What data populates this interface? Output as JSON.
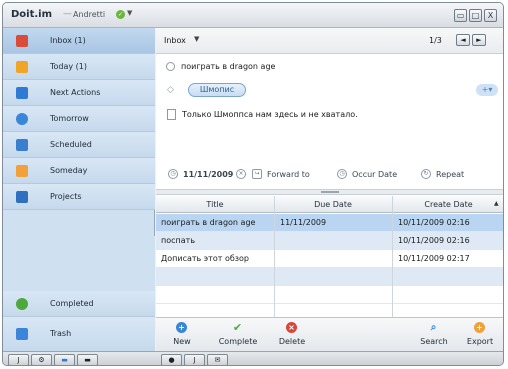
{
  "window": {
    "app_title": "Doit.im",
    "separator": "—",
    "user": "Andretti",
    "controls": {
      "minimize": "▭",
      "maximize": "□",
      "close": "X"
    }
  },
  "sidebar": {
    "items": [
      {
        "label": "Inbox (1)",
        "icon": "inbox-icon",
        "color": "#d94b3b",
        "selected": true
      },
      {
        "label": "Today (1)",
        "icon": "today-star-icon",
        "color": "#f1a528",
        "selected": false
      },
      {
        "label": "Next Actions",
        "icon": "next-actions-icon",
        "color": "#2f7bd4",
        "selected": false
      },
      {
        "label": "Tomorrow",
        "icon": "tomorrow-icon",
        "color": "#3a86d8",
        "selected": false
      },
      {
        "label": "Scheduled",
        "icon": "scheduled-calendar-icon",
        "color": "#3a7fcf",
        "selected": false
      },
      {
        "label": "Someday",
        "icon": "someday-folder-icon",
        "color": "#f0a13a",
        "selected": false
      },
      {
        "label": "Projects",
        "icon": "projects-icon",
        "color": "#2f6fbf",
        "selected": false
      },
      {
        "label": "Completed",
        "icon": "completed-check-icon",
        "color": "#4caa3c",
        "selected": false
      },
      {
        "label": "Trash",
        "icon": "trash-icon",
        "color": "#3a86d8",
        "selected": false
      }
    ]
  },
  "detail": {
    "box": "Inbox",
    "pager": "1/3",
    "prev": "◄",
    "next": "►",
    "task_title": "поиграть в dragon age",
    "tag": "Шмопис",
    "tag_add": "+▾",
    "note": "Только Шмоппса нам здесь и не хватало.",
    "meta": {
      "date": "11/11/2009",
      "forward": "Forward to",
      "occur": "Occur Date",
      "repeat": "Repeat"
    }
  },
  "grid": {
    "columns": [
      "Title",
      "Due Date",
      "Create Date"
    ],
    "sort_indicator": "▲",
    "rows": [
      {
        "title": "поиграть в dragon age",
        "due": "11/11/2009",
        "created": "10/11/2009 02:16",
        "selected": true
      },
      {
        "title": "поспать",
        "due": "",
        "created": "10/11/2009 02:16",
        "selected": false
      },
      {
        "title": "Дописать этот обзор",
        "due": "",
        "created": "10/11/2009 02:17",
        "selected": false
      }
    ]
  },
  "toolbar": {
    "new": "New",
    "complete": "Complete",
    "delete": "Delete",
    "search": "Search",
    "export": "Export"
  },
  "statusbar": {
    "left_buttons": [
      "J",
      "⚙",
      "▬",
      "▬"
    ],
    "right_buttons": [
      "●",
      "J",
      "✉"
    ]
  },
  "colors": {
    "accent": "#3a86d8",
    "selection": "#b9d5f1",
    "sidebar_bg": "#cfe0f0"
  }
}
